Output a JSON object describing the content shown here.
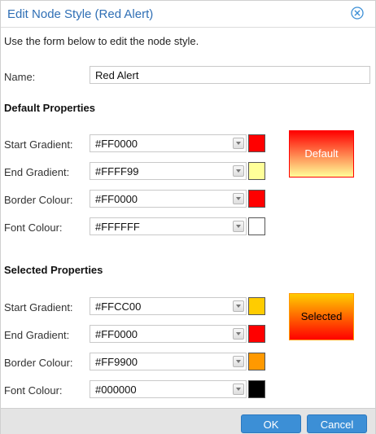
{
  "dialog": {
    "title": "Edit Node Style (Red Alert)",
    "intro": "Use the form below to edit the node style."
  },
  "name": {
    "label": "Name:",
    "value": "Red Alert"
  },
  "default_section": {
    "title": "Default Properties",
    "fields": [
      {
        "label": "Start Gradient:",
        "value": "#FF0000"
      },
      {
        "label": "End Gradient:",
        "value": "#FFFF99"
      },
      {
        "label": "Border Colour:",
        "value": "#FF0000"
      },
      {
        "label": "Font Colour:",
        "value": "#FFFFFF"
      }
    ],
    "preview_label": "Default"
  },
  "selected_section": {
    "title": "Selected Properties",
    "fields": [
      {
        "label": "Start Gradient:",
        "value": "#FFCC00"
      },
      {
        "label": "End Gradient:",
        "value": "#FF0000"
      },
      {
        "label": "Border Colour:",
        "value": "#FF9900"
      },
      {
        "label": "Font Colour:",
        "value": "#000000"
      }
    ],
    "preview_label": "Selected"
  },
  "buttons": {
    "ok": "OK",
    "cancel": "Cancel"
  },
  "colors": {
    "accent": "#2f6fb5",
    "button": "#3c8fd6"
  },
  "icons": {
    "close": "close-circle-icon",
    "dropdown": "chevron-down-icon"
  }
}
